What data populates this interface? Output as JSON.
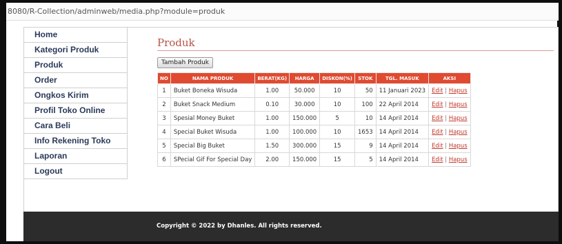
{
  "browser": {
    "url": "8080/R-Collection/adminweb/media.php?module=produk"
  },
  "sidebar": {
    "items": [
      {
        "label": "Home"
      },
      {
        "label": "Kategori Produk"
      },
      {
        "label": "Produk"
      },
      {
        "label": "Order"
      },
      {
        "label": "Ongkos Kirim"
      },
      {
        "label": "Profil Toko Online"
      },
      {
        "label": "Cara Beli"
      },
      {
        "label": "Info Rekening Toko"
      },
      {
        "label": "Laporan"
      },
      {
        "label": "Logout"
      }
    ]
  },
  "main": {
    "title": "Produk",
    "add_button": "Tambah Produk",
    "table": {
      "headers": [
        "NO",
        "NAMA PRODUK",
        "BERAT(KG)",
        "HARGA",
        "DISKON(%)",
        "STOK",
        "TGL. MASUK",
        "AKSI"
      ],
      "rows": [
        {
          "no": "1",
          "nama": "Buket Boneka Wisuda",
          "berat": "1.00",
          "harga": "50.000",
          "diskon": "10",
          "stok": "50",
          "tgl": "11 Januari 2023",
          "edit": "Edit",
          "sep": "|",
          "hapus": "Hapus"
        },
        {
          "no": "2",
          "nama": "Buket Snack Medium",
          "berat": "0.10",
          "harga": "30.000",
          "diskon": "10",
          "stok": "100",
          "tgl": "22 April 2014",
          "edit": "Edit",
          "sep": "|",
          "hapus": "Hapus"
        },
        {
          "no": "3",
          "nama": "Spesial Money Buket",
          "berat": "1.00",
          "harga": "150.000",
          "diskon": "5",
          "stok": "10",
          "tgl": "14 April 2014",
          "edit": "Edit",
          "sep": "|",
          "hapus": "Hapus"
        },
        {
          "no": "4",
          "nama": "Special Buket Wisuda",
          "berat": "1.00",
          "harga": "100.000",
          "diskon": "10",
          "stok": "1653",
          "tgl": "14 April 2014",
          "edit": "Edit",
          "sep": "|",
          "hapus": "Hapus"
        },
        {
          "no": "5",
          "nama": "Special Big Buket",
          "berat": "1.50",
          "harga": "300.000",
          "diskon": "15",
          "stok": "9",
          "tgl": "14 April 2014",
          "edit": "Edit",
          "sep": "|",
          "hapus": "Hapus"
        },
        {
          "no": "6",
          "nama": "SPecial Gif For Special Day",
          "berat": "2.00",
          "harga": "150.000",
          "diskon": "15",
          "stok": "5",
          "tgl": "14 April 2014",
          "edit": "Edit",
          "sep": "|",
          "hapus": "Hapus"
        }
      ]
    }
  },
  "footer": {
    "text": "Copyright © 2022 by Dhanles. All rights reserved."
  },
  "colors": {
    "title": "#b5534a",
    "table_header": "#e04a30",
    "footer_bg": "#2c2c2c",
    "link": "#c0392b",
    "nav_text": "#2a3a5a"
  }
}
